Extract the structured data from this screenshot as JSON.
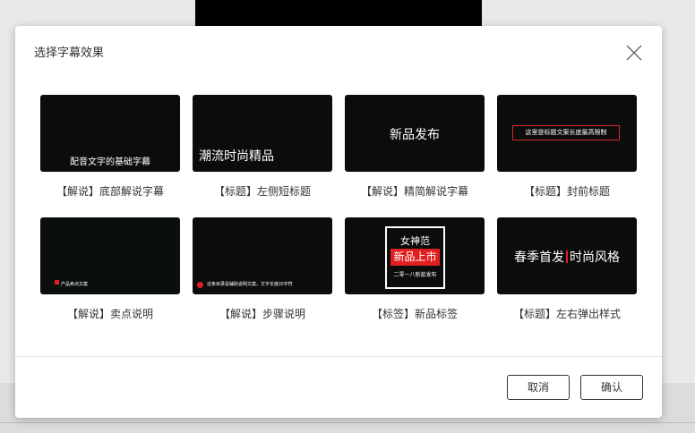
{
  "dialog": {
    "title": "选择字幕效果",
    "cancel_label": "取消",
    "confirm_label": "确认"
  },
  "templates": [
    {
      "caption": "【解说】底部解说字幕",
      "preview_text": "配音文字的基础字幕"
    },
    {
      "caption": "【标题】左侧短标题",
      "preview_text": "潮流时尚精品"
    },
    {
      "caption": "【解说】精简解说字幕",
      "preview_text": "新品发布"
    },
    {
      "caption": "【标题】封前标题",
      "preview_text": "这里是标题文案长度最高限制"
    },
    {
      "caption": "【解说】卖点说明",
      "preview_text": "产品卖点文案"
    },
    {
      "caption": "【解说】步骤说明",
      "preview_text": "这条目录是辅助说明文案，文字长度20字符"
    },
    {
      "caption": "【标签】新品标签",
      "preview_lines": [
        "女神范",
        "新品上市",
        "二零一八新款发布"
      ]
    },
    {
      "caption": "【标题】左右弹出样式",
      "preview_left": "春季首发",
      "preview_right": "时尚风格"
    }
  ],
  "colors": {
    "accent_red": "#e02020",
    "thumb_bg": "#0c0c0c"
  }
}
